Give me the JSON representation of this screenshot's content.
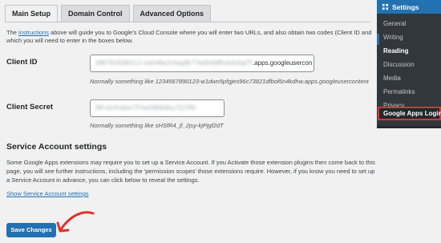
{
  "tabs": [
    {
      "label": "Main Setup"
    },
    {
      "label": "Domain Control"
    },
    {
      "label": "Advanced Options"
    }
  ],
  "intro": {
    "prefix": "The ",
    "link": "instructions",
    "suffix": " above will guide you to Google's Cloud Console where you will enter two URLs, and also obtain two codes (Client ID and",
    "line2": "which you will need to enter in the boxes below."
  },
  "client_id": {
    "label": "Client ID",
    "value_blurred": "4867918390112-mkir48a1h4ag8k77bdfmfdffhvkdcfqd7fc",
    "value_visible": ".apps.googleusercon",
    "hint": "Normally something like 1234567890123-w1dwn5pfgjeo96c73821dfbof6n4kdhw.apps.googleusercontent"
  },
  "client_secret": {
    "label": "Client Secret",
    "value_blurred": "9fFx0cfmbhrr7Fhe038Wdhu7Q7Rfr",
    "hint": "Normally something like sHSfR4_jf_2jsy-kjPjgf2dT"
  },
  "service_account": {
    "title": "Service Account settings",
    "text": "Some Google Apps extensions may require you to set up a Service Account. If you Activate those extension plugins then come back to this page, you will see further instructions, including the 'permission scopes' those extensions require. However, if you know you need to set up a Service Account in advance, you can click below to reveal the settings.",
    "link": "Show Service Account settings"
  },
  "save_button": "Save Changes",
  "wp_menu": {
    "title": "Settings",
    "items": [
      "General",
      "Writing",
      "Reading",
      "Discussion",
      "Media",
      "Permalinks",
      "Privacy"
    ],
    "current": "Reading",
    "highlighted": "Google Apps Login"
  },
  "colors": {
    "accent": "#2271b1",
    "highlight_border": "#d63638",
    "arrow": "#e0322b"
  }
}
